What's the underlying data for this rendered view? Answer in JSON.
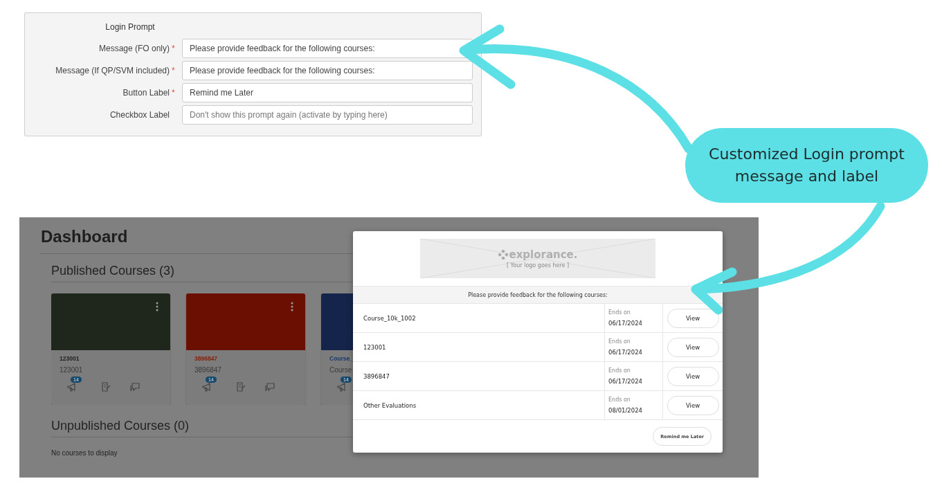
{
  "settings_panel": {
    "title": "Login Prompt",
    "fields": [
      {
        "label": "Message (FO only)",
        "required_mark": "*",
        "value": "Please provide feedback for the following courses:"
      },
      {
        "label": "Message (If QP/SVM included)",
        "required_mark": "*",
        "value": "Please provide feedback for the following courses:"
      },
      {
        "label": "Button Label",
        "required_mark": "*",
        "value": "Remind me Later"
      },
      {
        "label": "Checkbox Label",
        "placeholder": "Don't show this prompt again (activate by typing here)"
      }
    ]
  },
  "callout": {
    "text": "Customized Login prompt message and label"
  },
  "dashboard": {
    "title": "Dashboard",
    "published_heading": "Published Courses (3)",
    "cards": [
      {
        "title": "123001",
        "subtitle": "123001",
        "color": "#1f271d",
        "badge": "14"
      },
      {
        "title": "3896847",
        "subtitle": "3896847",
        "color": "#6b0f03",
        "badge": "14"
      },
      {
        "title": "Course_",
        "subtitle": "Course",
        "color": "#14244a",
        "badge": "14"
      }
    ],
    "unpublished_heading": "Unpublished Courses (0)",
    "empty_text": "No courses to display"
  },
  "modal": {
    "logo_text": "explorance.",
    "logo_caption": "[ Your logo goes here ]",
    "message": "Please provide feedback for the following courses:",
    "rows": [
      {
        "name": "Course_10k_1002",
        "ends_label": "Ends on",
        "date": "06/17/2024",
        "button": "View"
      },
      {
        "name": "123001",
        "ends_label": "Ends on",
        "date": "06/17/2024",
        "button": "View"
      },
      {
        "name": "3896847",
        "ends_label": "Ends on",
        "date": "06/17/2024",
        "button": "View"
      },
      {
        "name": "Other Evaluations",
        "ends_label": "Ends on",
        "date": "08/01/2024",
        "button": "View"
      }
    ],
    "footer_button": "Remind me Later"
  }
}
